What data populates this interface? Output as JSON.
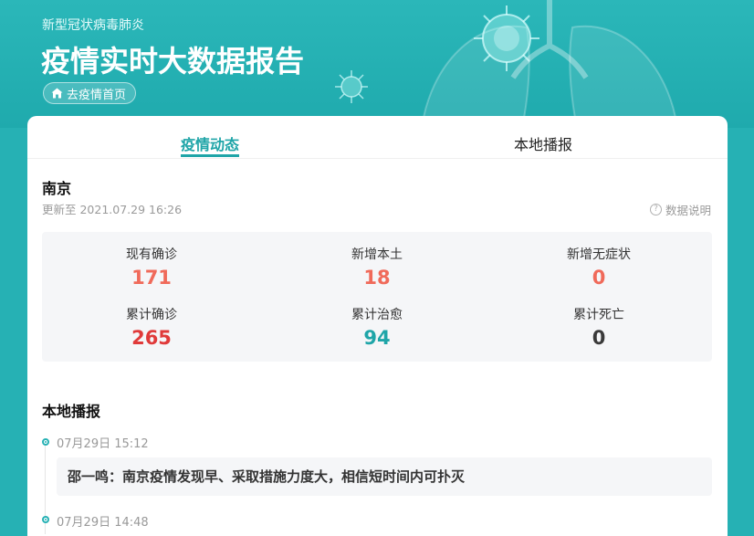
{
  "header": {
    "subtitle": "新型冠状病毒肺炎",
    "title": "疫情实时大数据报告",
    "home_button": "去疫情首页"
  },
  "tabs": [
    {
      "label": "疫情动态",
      "active": true
    },
    {
      "label": "本地播报",
      "active": false
    }
  ],
  "city": "南京",
  "update_time": "更新至 2021.07.29 16:26",
  "data_explain": "数据说明",
  "stats": [
    {
      "label": "现有确诊",
      "value": "171",
      "color": "#f06a5a"
    },
    {
      "label": "新增本土",
      "value": "18",
      "color": "#f06a5a"
    },
    {
      "label": "新增无症状",
      "value": "0",
      "color": "#f06a5a"
    },
    {
      "label": "累计确诊",
      "value": "265",
      "color": "#e03a3a"
    },
    {
      "label": "累计治愈",
      "value": "94",
      "color": "#1fa5a8"
    },
    {
      "label": "累计死亡",
      "value": "0",
      "color": "#3a3a3a"
    }
  ],
  "local_section_title": "本地播报",
  "news": [
    {
      "time": "07月29日  15:12",
      "title": "邵一鸣：南京疫情发现早、采取措施力度大，相信短时间内可扑灭"
    },
    {
      "time": "07月29日  14:48",
      "title": ""
    }
  ],
  "colors": {
    "brand": "#26b1b4",
    "active_tab": "#1fa5a8"
  }
}
